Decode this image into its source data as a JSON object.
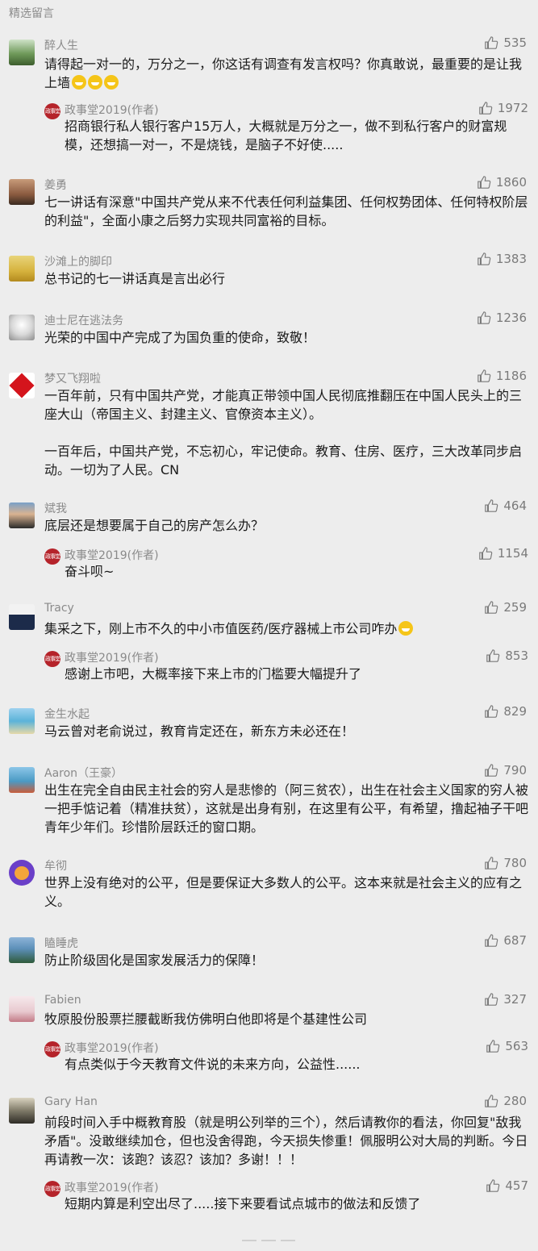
{
  "section_title": "精选留言",
  "author_reply_name": "政事堂2019(作者)",
  "author_avatar_text": "政事堂",
  "comments": [
    {
      "name": "醉人生",
      "likes": "535",
      "text": "请得起一对一的，万分之一，你这话有调查有发言权吗？你真敢说，最重要的是让我上墙",
      "reply_text": "招商银行私人银行客户15万人，大概就是万分之一，做不到私行客户的财富规模，还想搞一对一，不是烧钱，是脑子不好使.....",
      "reply_likes": "1972"
    },
    {
      "name": "姜勇",
      "likes": "1860",
      "text": "七一讲话有深意\"中国共产党从来不代表任何利益集团、任何权势团体、任何特权阶层的利益\"，全面小康之后努力实现共同富裕的目标。"
    },
    {
      "name": "沙滩上的脚印",
      "likes": "1383",
      "text": "总书记的七一讲话真是言出必行"
    },
    {
      "name": "迪士尼在逃法务",
      "likes": "1236",
      "text": "光荣的中国中产完成了为国负重的使命，致敬！"
    },
    {
      "name": "梦又飞翔啦",
      "likes": "1186",
      "text": "一百年前，只有中国共产党，才能真正带领中国人民彻底推翻压在中国人民头上的三座大山（帝国主义、封建主义、官僚资本主义）。",
      "text2": "一百年后，中国共产党，不忘初心，牢记使命。教育、住房、医疗，三大改革同步启动。一切为了人民。CN"
    },
    {
      "name": "斌我",
      "likes": "464",
      "text": "底层还是想要属于自己的房产怎么办？",
      "reply_text": "奋斗呗~",
      "reply_likes": "1154"
    },
    {
      "name": "Tracy",
      "likes": "259",
      "text": "集采之下，刚上市不久的中小市值医药/医疗器械上市公司咋办",
      "reply_text": "感谢上市吧，大概率接下来上市的门槛要大幅提升了",
      "reply_likes": "853"
    },
    {
      "name": "金生水起",
      "likes": "829",
      "text": "马云曾对老俞说过，教育肯定还在，新东方未必还在！"
    },
    {
      "name": "Aaron（王豪）",
      "likes": "790",
      "text": "出生在完全自由民主社会的穷人是悲惨的（阿三贫农），出生在社会主义国家的穷人被一把手惦记着（精准扶贫），这就是出身有别，在这里有公平，有希望，撸起袖子干吧青年少年们。珍惜阶层跃迁的窗口期。"
    },
    {
      "name": "牟彻",
      "likes": "780",
      "text": "世界上没有绝对的公平，但是要保证大多数人的公平。这本来就是社会主义的应有之义。"
    },
    {
      "name": "瞌睡虎",
      "likes": "687",
      "text": "防止阶级固化是国家发展活力的保障！"
    },
    {
      "name": "Fabien",
      "likes": "327",
      "text": "牧原股份股票拦腰截断我仿佛明白他即将是个基建性公司",
      "reply_text": "有点类似于今天教育文件说的未来方向，公益性......",
      "reply_likes": "563"
    },
    {
      "name": "Gary Han",
      "likes": "280",
      "text": "前段时间入手中概教育股（就是明公列举的三个），然后请教你的看法，你回复\"敌我矛盾\"。没敢继续加仓，但也没舍得跑，今天损失惨重！佩服明公对大局的判断。今日再请教一次：该跑？该忍？该加？多谢！！！",
      "reply_text": "短期内算是利空出尽了.....接下来要看试点城市的做法和反馈了",
      "reply_likes": "457"
    }
  ]
}
